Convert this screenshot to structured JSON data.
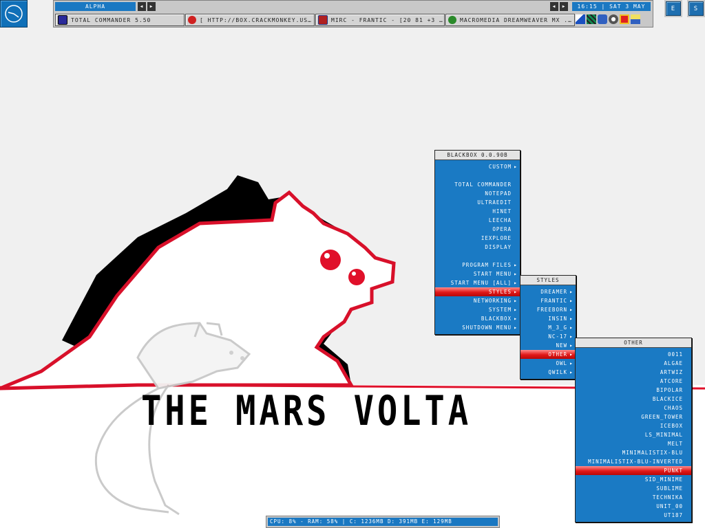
{
  "wallpaper": {
    "title": "THE MARS VOLTA"
  },
  "toolbar": {
    "workspace": "ALPHA",
    "clock": "16:15 | SAT 3 MAY",
    "tasks": [
      {
        "label": "TOTAL COMMANDER 5.50"
      },
      {
        "label": "[ HTTP://BOX.CRACKMONKEY.US/..."
      },
      {
        "label": "MIRC - FRANTIC - [20 81 +3 0..."
      },
      {
        "label": "MACROMEDIA DREAMWEAVER MX ..."
      }
    ]
  },
  "corner": {
    "e": "E",
    "s": "S"
  },
  "menus": {
    "main": {
      "title": "BLACKBOX 0.0.90B",
      "items": [
        "CUSTOM",
        "",
        "TOTAL COMMANDER",
        "NOTEPAD",
        "ULTRAEDIT",
        "HINET",
        "LEECHA",
        "OPERA",
        "IEXPLORE",
        "DISPLAY",
        "",
        "PROGRAM FILES",
        "START MENU",
        "START MENU [ALL]",
        "STYLES",
        "NETWORKING",
        "SYSTEM",
        "BLACKBOX",
        "SHUTDOWN MENU"
      ]
    },
    "styles": {
      "title": "STYLES",
      "items": [
        "DREAMER",
        "FRANTIC",
        "FREEBORN",
        "INSIN",
        "M_3_G",
        "NC-17",
        "NEW",
        "OTHER",
        "OWL",
        "QWILK"
      ]
    },
    "other": {
      "title": "OTHER",
      "items": [
        "0011",
        "ALGAE",
        "ARTWIZ",
        "ATCORE",
        "BIPOLAR",
        "BLACKICE",
        "CHAOS",
        "GREEN_TOWER",
        "ICEBOX",
        "LS_MINIMAL",
        "MELT",
        "MINIMALISTIX-BLU",
        "MINIMALISTIX-BLU-INVERTED",
        "PUNKT",
        "SID_MINIME",
        "SUBLIME",
        "TECHNIKA",
        "UNIT_00",
        "UT187"
      ]
    }
  },
  "statusbar": {
    "text": "CPU: 8% - RAM: 58% | C: 1236MB D: 391MB E: 129MB"
  },
  "colors": {
    "menu_bg": "#1a7ac4",
    "highlight": "#e01818",
    "wall_red": "#e0102a"
  }
}
